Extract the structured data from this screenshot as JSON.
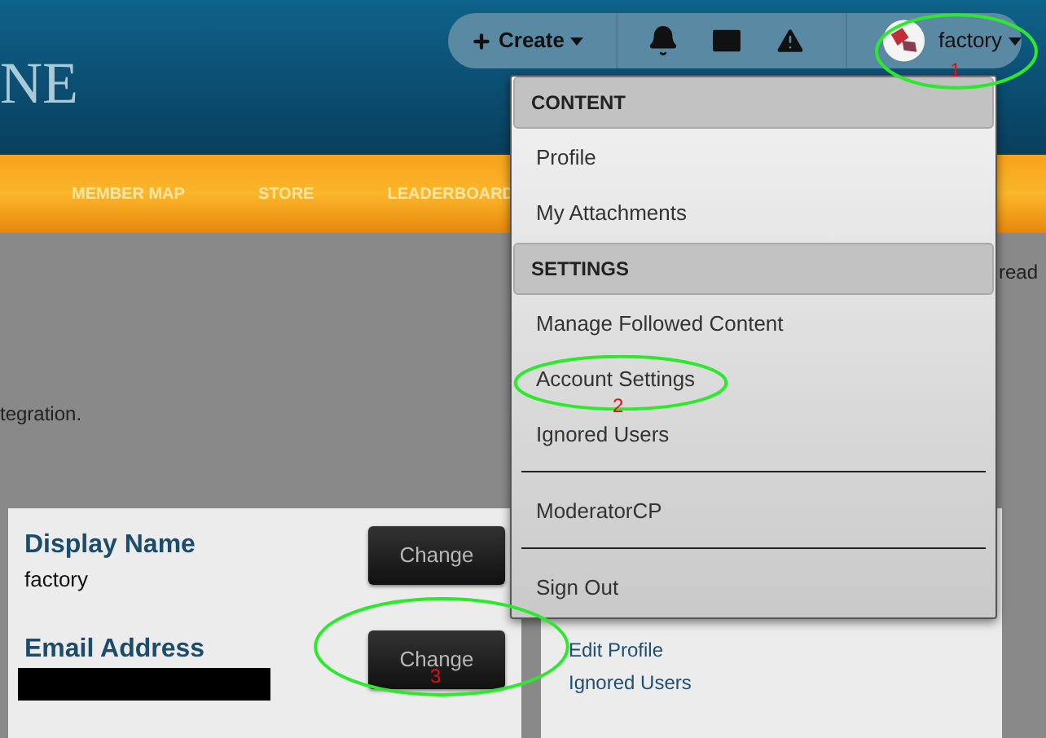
{
  "header": {
    "logo_text": "NE",
    "create_label": "Create",
    "username": "factory"
  },
  "nav": {
    "items": [
      "MEMBER MAP",
      "STORE",
      "LEADERBOARD"
    ]
  },
  "page": {
    "right_fragment": "read",
    "intro_fragment": "tegration."
  },
  "account_card": {
    "fields": [
      {
        "kind": "text",
        "label": "Display Name",
        "value": "factory",
        "button": "Change"
      },
      {
        "kind": "redacted",
        "label": "Email Address",
        "button": "Change"
      }
    ]
  },
  "links_card": {
    "links": [
      "Edit Profile",
      "Ignored Users"
    ]
  },
  "user_menu": {
    "entries": [
      {
        "kind": "header",
        "label": "CONTENT"
      },
      {
        "kind": "item",
        "label": "Profile"
      },
      {
        "kind": "item",
        "label": "My Attachments"
      },
      {
        "kind": "header",
        "label": "SETTINGS"
      },
      {
        "kind": "item",
        "label": "Manage Followed Content"
      },
      {
        "kind": "item",
        "label": "Account Settings"
      },
      {
        "kind": "item",
        "label": "Ignored Users"
      },
      {
        "kind": "divider"
      },
      {
        "kind": "item",
        "label": "ModeratorCP"
      },
      {
        "kind": "divider"
      },
      {
        "kind": "item",
        "label": "Sign Out"
      }
    ]
  },
  "annotations": [
    {
      "number": "1"
    },
    {
      "number": "2"
    },
    {
      "number": "3"
    }
  ]
}
